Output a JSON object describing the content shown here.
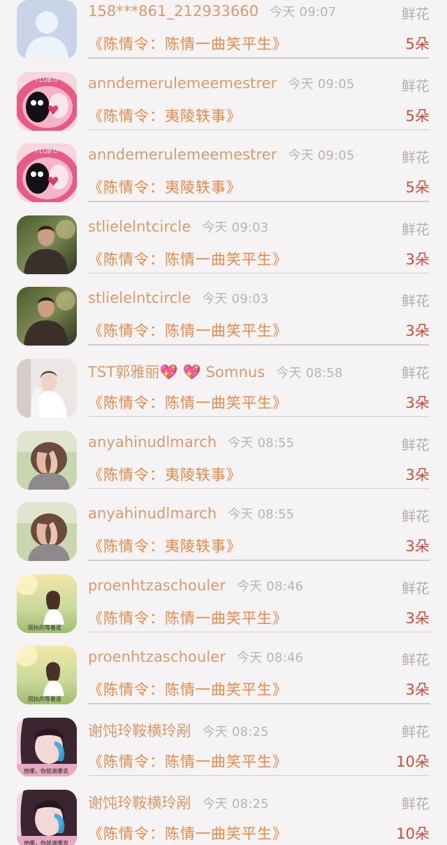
{
  "rows": [
    {
      "name": "158***861_212933660",
      "time": "今天 09:07",
      "gift": "鲜花",
      "title": "《陈情令：陈情一曲笑平生》",
      "count": "5朵",
      "avatar": "default-person"
    },
    {
      "name": "anndemerulemeemestrer",
      "time": "今天 09:05",
      "gift": "鲜花",
      "title": "《陈情令：夷陵轶事》",
      "count": "5朵",
      "avatar": "cartoon-love"
    },
    {
      "name": "anndemerulemeemestrer",
      "time": "今天 09:05",
      "gift": "鲜花",
      "title": "《陈情令：夷陵轶事》",
      "count": "5朵",
      "avatar": "cartoon-love"
    },
    {
      "name": "stlielelntcircle",
      "time": "今天 09:03",
      "gift": "鲜花",
      "title": "《陈情令：陈情一曲笑平生》",
      "count": "3朵",
      "avatar": "man-photo"
    },
    {
      "name": "stlielelntcircle",
      "time": "今天 09:03",
      "gift": "鲜花",
      "title": "《陈情令：陈情一曲笑平生》",
      "count": "3朵",
      "avatar": "man-photo"
    },
    {
      "name": "TST郭雅丽💖 💖 Somnus",
      "time": "今天 08:58",
      "gift": "鲜花",
      "title": "《陈情令：陈情一曲笑平生》",
      "count": "3朵",
      "avatar": "bride-photo"
    },
    {
      "name": "anyahinudlmarch",
      "time": "今天 08:55",
      "gift": "鲜花",
      "title": "《陈情令：夷陵轶事》",
      "count": "3朵",
      "avatar": "hands-photo"
    },
    {
      "name": "anyahinudlmarch",
      "time": "今天 08:55",
      "gift": "鲜花",
      "title": "《陈情令：夷陵轶事》",
      "count": "3朵",
      "avatar": "hands-photo"
    },
    {
      "name": "proenhtzaschouler",
      "time": "今天 08:46",
      "gift": "鲜花",
      "title": "《陈情令：陈情一曲笑平生》",
      "count": "3朵",
      "avatar": "girl-field-photo",
      "avatar_caption": "固执的等着谁"
    },
    {
      "name": "proenhtzaschouler",
      "time": "今天 08:46",
      "gift": "鲜花",
      "title": "《陈情令：陈情一曲笑平生》",
      "count": "3朵",
      "avatar": "girl-field-photo",
      "avatar_caption": "固执的等着谁"
    },
    {
      "name": "谢饨玲鞍横玲剐",
      "time": "今天 08:25",
      "gift": "鲜花",
      "title": "《陈情令：陈情一曲笑平生》",
      "count": "10朵",
      "avatar": "girl-pink-photo",
      "avatar_caption": "他哪，你就滚哪去"
    },
    {
      "name": "谢饨玲鞍横玲剐",
      "time": "今天 08:25",
      "gift": "鲜花",
      "title": "《陈情令：陈情一曲笑平生》",
      "count": "10朵",
      "avatar": "girl-pink-photo",
      "avatar_caption": "他哪，你就滚哪去"
    }
  ],
  "colors": {
    "background": "#f6f3f5",
    "name": "#d99a6c",
    "title": "#e88a45",
    "count": "#cf4c3b",
    "meta": "#b9b3b6"
  }
}
